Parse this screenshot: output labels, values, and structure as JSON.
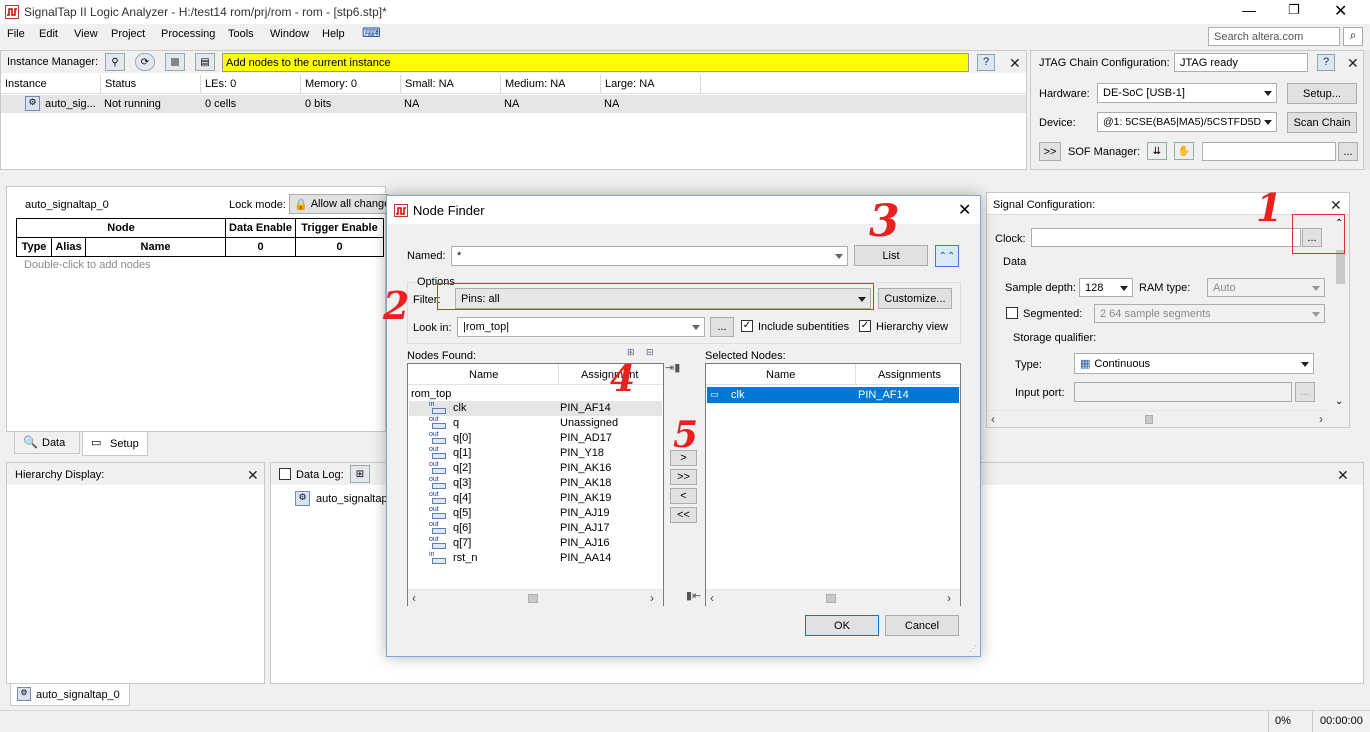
{
  "window": {
    "title": "SignalTap II Logic Analyzer - H:/test14 rom/prj/rom - rom - [stp6.stp]*",
    "search_placeholder": "Search altera.com"
  },
  "menu": [
    "File",
    "Edit",
    "View",
    "Project",
    "Processing",
    "Tools",
    "Window",
    "Help"
  ],
  "instance_manager": {
    "label": "Instance Manager:",
    "message": "Add nodes to the current instance",
    "columns": [
      "Instance",
      "Status",
      "LEs: 0",
      "Memory: 0",
      "Small: NA",
      "Medium: NA",
      "Large: NA"
    ],
    "row": [
      "auto_sig...",
      "Not running",
      "0 cells",
      "0 bits",
      "NA",
      "NA",
      "NA"
    ]
  },
  "jtag": {
    "label": "JTAG Chain Configuration:",
    "status": "JTAG ready",
    "hardware_label": "Hardware:",
    "hardware": "DE-SoC [USB-1]",
    "setup": "Setup...",
    "device_label": "Device:",
    "device": "@1: 5CSE(BA5|MA5)/5CSTFD5D",
    "scan": "Scan Chain",
    "sof_expand": ">>",
    "sof_label": "SOF Manager:",
    "browse": "..."
  },
  "node_panel": {
    "instance": "auto_signaltap_0",
    "lock_label": "Lock mode:",
    "lock_value": "Allow all changes",
    "col_node": "Node",
    "col_data_enable": "Data Enable",
    "col_trigger_enable": "Trigger Enable",
    "col_type": "Type",
    "col_alias": "Alias",
    "col_name": "Name",
    "data_enable_val": "0",
    "trigger_enable_val": "0",
    "hint": "Double-click to add nodes"
  },
  "tabs": {
    "data": "Data",
    "setup": "Setup"
  },
  "hierarchy": {
    "title": "Hierarchy Display:"
  },
  "datalog": {
    "title": "Data Log:",
    "item": "auto_signaltap"
  },
  "signal_config": {
    "title": "Signal Configuration:",
    "clock_label": "Clock:",
    "browse": "...",
    "data_label": "Data",
    "sample_depth_label": "Sample depth:",
    "sample_depth": "128",
    "ram_type_label": "RAM type:",
    "ram_type": "Auto",
    "segmented_label": "Segmented:",
    "segmented_value": "2  64 sample segments",
    "storage_label": "Storage qualifier:",
    "type_label": "Type:",
    "type_value": "Continuous",
    "input_port_label": "Input port:"
  },
  "dialog": {
    "title": "Node Finder",
    "named_label": "Named:",
    "named_value": "*",
    "list_button": "List",
    "options_label": "Options",
    "filter_label": "Filter:",
    "filter_value": "Pins: all",
    "customize_button": "Customize...",
    "lookin_label": "Look in:",
    "lookin_value": "|rom_top|",
    "browse": "...",
    "include_sub": "Include subentities",
    "hier_view": "Hierarchy view",
    "found_label": "Nodes Found:",
    "selected_label": "Selected Nodes:",
    "col_name": "Name",
    "col_assignment": "Assignment",
    "col_assignments": "Assignments",
    "root": "rom_top",
    "found": [
      {
        "dir": "in",
        "name": "clk",
        "pin": "PIN_AF14"
      },
      {
        "dir": "out",
        "name": "q",
        "pin": "Unassigned"
      },
      {
        "dir": "out",
        "name": "q[0]",
        "pin": "PIN_AD17"
      },
      {
        "dir": "out",
        "name": "q[1]",
        "pin": "PIN_Y18"
      },
      {
        "dir": "out",
        "name": "q[2]",
        "pin": "PIN_AK16"
      },
      {
        "dir": "out",
        "name": "q[3]",
        "pin": "PIN_AK18"
      },
      {
        "dir": "out",
        "name": "q[4]",
        "pin": "PIN_AK19"
      },
      {
        "dir": "out",
        "name": "q[5]",
        "pin": "PIN_AJ19"
      },
      {
        "dir": "out",
        "name": "q[6]",
        "pin": "PIN_AJ17"
      },
      {
        "dir": "out",
        "name": "q[7]",
        "pin": "PIN_AJ16"
      },
      {
        "dir": "in",
        "name": "rst_n",
        "pin": "PIN_AA14"
      }
    ],
    "selected": [
      {
        "name": "clk",
        "pin": "PIN_AF14"
      }
    ],
    "move_buttons": [
      ">",
      ">>",
      "<",
      "<<"
    ],
    "ok": "OK",
    "cancel": "Cancel"
  },
  "bottom_tab": "auto_signaltap_0",
  "status": {
    "percent": "0%",
    "time": "00:00:00"
  },
  "annotations": [
    "1",
    "2",
    "3",
    "4",
    "5"
  ]
}
